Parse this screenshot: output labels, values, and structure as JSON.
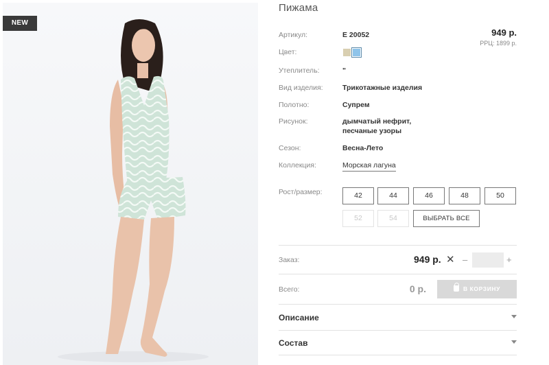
{
  "badge": "NEW",
  "product": {
    "title": "Пижама",
    "price": "949 р.",
    "rrp": "РРЦ: 1899 р."
  },
  "colors": {
    "label": "Цвет:",
    "swatches": [
      "#d9cfb1",
      "#8fc4ea"
    ],
    "selected_index": 1
  },
  "specs": [
    {
      "label": "Артикул:",
      "value": "E 20052"
    },
    {
      "label": "Утеплитель:",
      "value": "\""
    },
    {
      "label": "Вид изделия:",
      "value": "Трикотажные изделия"
    },
    {
      "label": "Полотно:",
      "value": "Супрем"
    },
    {
      "label": "Рисунок:",
      "value": "дымчатый нефрит,",
      "value2": "песчаные узоры"
    },
    {
      "label": "Сезон:",
      "value": "Весна-Лето"
    },
    {
      "label": "Коллекция:",
      "value": "Морская лагуна"
    }
  ],
  "sizes": {
    "label": "Рост/размер:",
    "items": [
      {
        "label": "42",
        "available": true
      },
      {
        "label": "44",
        "available": true
      },
      {
        "label": "46",
        "available": true
      },
      {
        "label": "48",
        "available": true
      },
      {
        "label": "50",
        "available": true
      },
      {
        "label": "52",
        "available": false
      },
      {
        "label": "54",
        "available": false
      }
    ],
    "select_all": "ВЫБРАТЬ ВСЕ"
  },
  "order": {
    "label": "Заказ:",
    "price": "949 р.",
    "times": "✕",
    "minus": "–",
    "plus": "+",
    "quantity": ""
  },
  "total": {
    "label": "Всего:",
    "value": "0 р.",
    "cart_button": "В КОРЗИНУ"
  },
  "accordions": [
    {
      "label": "Описание"
    },
    {
      "label": "Состав"
    }
  ]
}
